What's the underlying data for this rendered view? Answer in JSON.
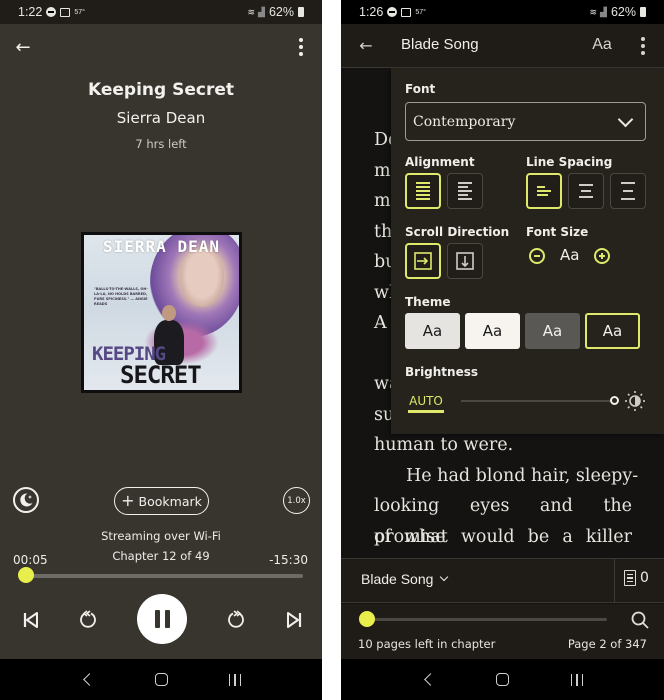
{
  "left_screen": {
    "status_bar": {
      "time": "1:22",
      "temperature": "57°",
      "battery": "62%"
    },
    "app_bar": {
      "back_icon": "arrow-left-icon",
      "more_icon": "more-vertical-icon"
    },
    "book": {
      "title": "Keeping Secret",
      "author": "Sierra Dean",
      "time_left": "7 hrs left",
      "cover": {
        "author_text": "SIERRA DEAN",
        "quote": "\"BALLS-TO-THE-WALLS, OH-LA-LA, NO HOLDS BARRED, PURE SPICINESS.\" — ANGIE READS",
        "title_line1": "KEEPING",
        "title_line2": "SECRET"
      }
    },
    "controls": {
      "sleep_timer_icon": "moon-icon",
      "bookmark_label": "Bookmark",
      "bookmark_plus": "+",
      "speed_label": "1.0x"
    },
    "streaming_status": "Streaming over Wi-Fi",
    "chapter_label": "Chapter 12 of 49",
    "elapsed_time": "00:05",
    "remaining_time": "-15:30",
    "progress_fraction": 0.005,
    "playback": {
      "previous_icon": "skip-previous-icon",
      "rewind_icon": "rewind-icon",
      "pause_icon": "pause-icon",
      "forward_icon": "fast-forward-icon",
      "next_icon": "skip-next-icon"
    },
    "accent_color": "#e8ef4d"
  },
  "right_screen": {
    "status_bar": {
      "time": "1:26",
      "temperature": "57°",
      "battery": "62%"
    },
    "app_bar": {
      "title": "Blade Song",
      "font_settings_label": "Aa"
    },
    "book_text_lines": [
      {
        "text": "De",
        "style": "plain"
      },
      {
        "text": "m",
        "style": "plain"
      },
      {
        "text": "m",
        "style": "plain"
      },
      {
        "text": "th",
        "style": "plain"
      },
      {
        "text": "bu",
        "style": "plain"
      },
      {
        "text": "wh",
        "style": "plain"
      },
      {
        "text": "A",
        "style": "plain"
      },
      {
        "text": "",
        "style": "plain"
      },
      {
        "text": "wa",
        "style": "plain"
      },
      {
        "text": "su",
        "style": "plain"
      },
      {
        "text": "human to were.",
        "style": "plain"
      },
      {
        "text": "He had blond hair, sleepy-",
        "style": "indent"
      },
      {
        "text": "looking eyes and the promise",
        "style": "justify"
      },
      {
        "text": "of what would be a killer",
        "style": "justify"
      }
    ],
    "settings": {
      "font_label": "Font",
      "font_value": "Contemporary",
      "alignment_label": "Alignment",
      "alignment_options": [
        "justified",
        "left"
      ],
      "alignment_selected": "justified",
      "line_spacing_label": "Line Spacing",
      "line_spacing_options": [
        "compact",
        "normal",
        "wide"
      ],
      "line_spacing_selected": "compact",
      "scroll_direction_label": "Scroll Direction",
      "scroll_direction_options": [
        "horizontal",
        "vertical"
      ],
      "scroll_direction_selected": "horizontal",
      "font_size_label": "Font Size",
      "font_size_sample": "Aa",
      "theme_label": "Theme",
      "themes": [
        {
          "name": "light-gray",
          "label": "Aa",
          "bg": "#e6e4e1",
          "fg": "#1a1a1a"
        },
        {
          "name": "white",
          "label": "Aa",
          "bg": "#f7f4ef",
          "fg": "#1a1a1a"
        },
        {
          "name": "gray",
          "label": "Aa",
          "bg": "#5a5854",
          "fg": "#f2f0ec"
        },
        {
          "name": "dark",
          "label": "Aa",
          "bg": "#26231d",
          "fg": "#f2f0ec"
        }
      ],
      "theme_selected": "dark",
      "brightness_label": "Brightness",
      "brightness_auto_label": "AUTO",
      "brightness_level": 1.0
    },
    "bottom_bar": {
      "book_select_label": "Blade Song",
      "notes_count": "0"
    },
    "footer": {
      "pages_left": "10 pages left in chapter",
      "page_indicator": "Page 2 of 347",
      "progress_fraction": 0.006
    },
    "accent_color": "#dfe86a"
  }
}
